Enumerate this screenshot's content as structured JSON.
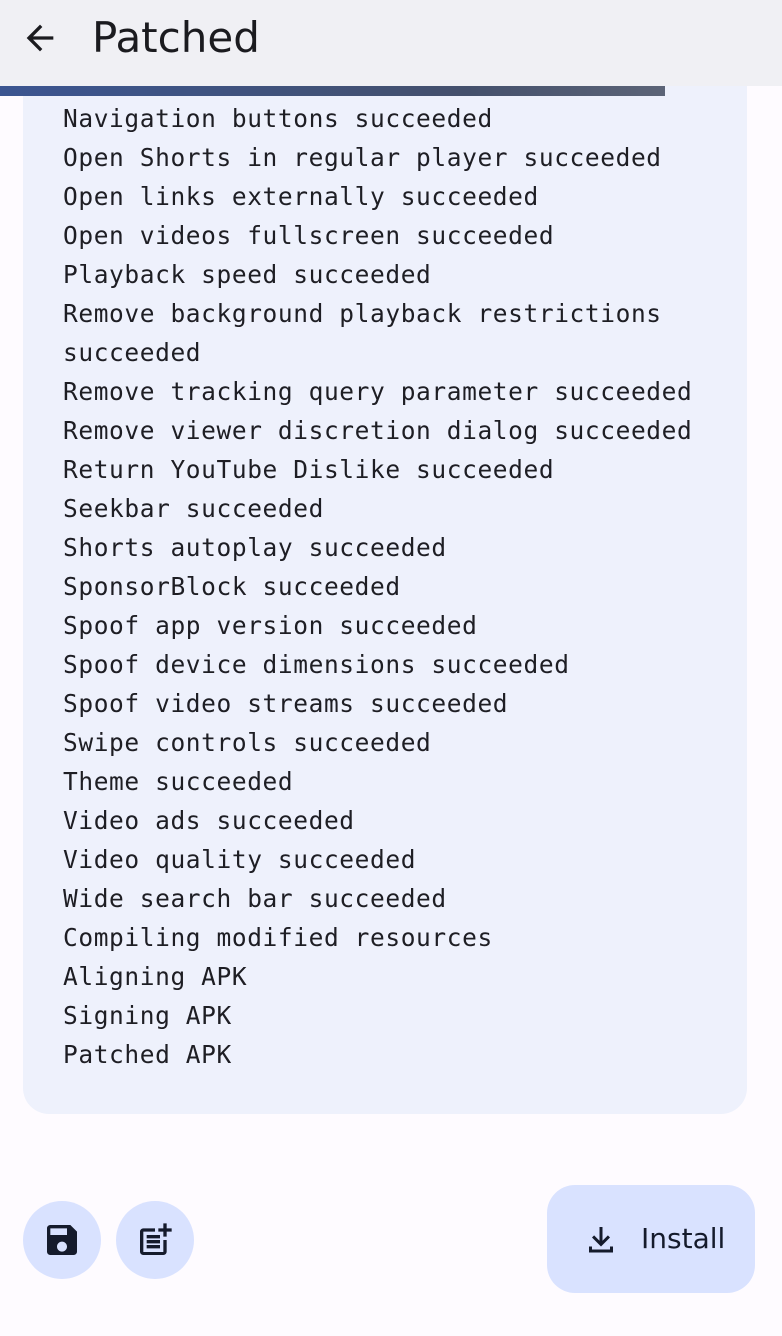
{
  "header": {
    "title": "Patched",
    "back_icon": "arrow-back-icon"
  },
  "progress": {
    "fraction": 0.851
  },
  "log": {
    "lines": [
      "Navigation buttons succeeded",
      "Open Shorts in regular player succeeded",
      "Open links externally succeeded",
      "Open videos fullscreen succeeded",
      "Playback speed succeeded",
      "Remove background playback restrictions succeeded",
      "Remove tracking query parameter succeeded",
      "Remove viewer discretion dialog succeeded",
      "Return YouTube Dislike succeeded",
      "Seekbar succeeded",
      "Shorts autoplay succeeded",
      "SponsorBlock succeeded",
      "Spoof app version succeeded",
      "Spoof device dimensions succeeded",
      "Spoof video streams succeeded",
      "Swipe controls succeeded",
      "Theme succeeded",
      "Video ads succeeded",
      "Video quality succeeded",
      "Wide search bar succeeded",
      "Compiling modified resources",
      "Aligning APK",
      "Signing APK",
      "Patched APK"
    ]
  },
  "actions": {
    "save_icon": "save-icon",
    "export_log_icon": "post-add-icon",
    "install_label": "Install",
    "install_icon": "download-icon"
  },
  "colors": {
    "accent_container": "#d9e2ff",
    "card_background": "#eef1fc",
    "progress": "#3b5591"
  }
}
